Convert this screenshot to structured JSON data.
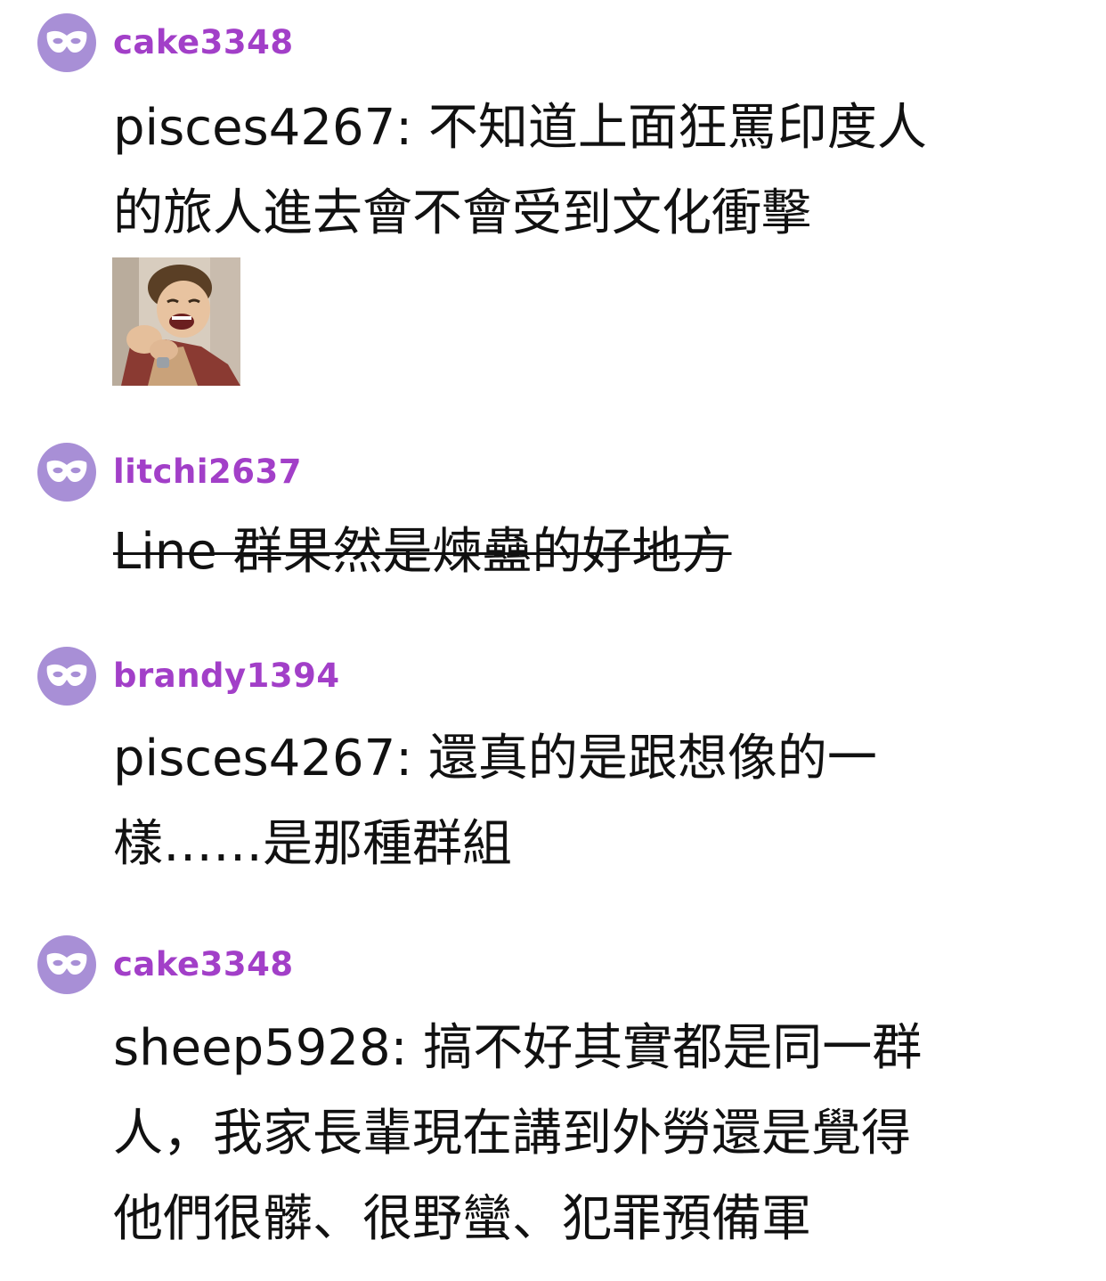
{
  "comments": [
    {
      "username": "cake3348",
      "avatar_icon": "mask-icon",
      "text_line1": "pisces4267: 不知道上面狂罵印度人",
      "text_line2": "的旅人進去會不會受到文化衝擊",
      "has_image": true
    },
    {
      "username": "litchi2637",
      "avatar_icon": "mask-icon",
      "text_line1": "Line 群果然是煉蠱的好地方",
      "strikethrough": true
    },
    {
      "username": "brandy1394",
      "avatar_icon": "mask-icon",
      "text_line1": "pisces4267: 還真的是跟想像的一",
      "text_line2": "樣……是那種群組"
    },
    {
      "username": "cake3348",
      "avatar_icon": "mask-icon",
      "text_line1": "sheep5928: 搞不好其實都是同一群",
      "text_line2": "人，我家長輩現在講到外勞還是覺得",
      "text_line3": "他們很髒、很野蠻、犯罪預備軍"
    }
  ],
  "colors": {
    "avatar_bg": "#a88fd6",
    "username": "#a23fc8",
    "text": "#111111"
  }
}
